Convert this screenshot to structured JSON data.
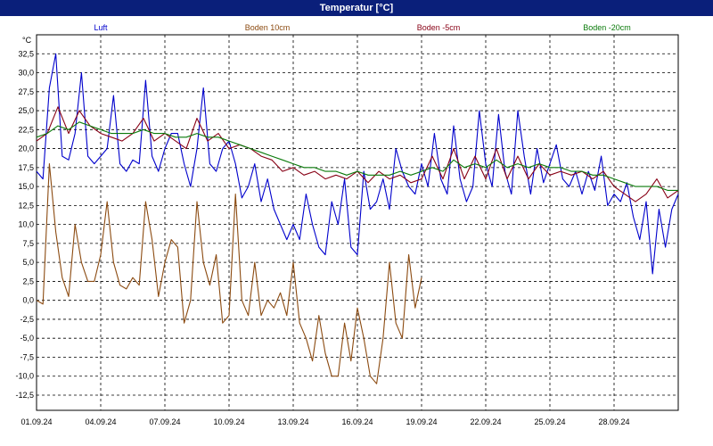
{
  "window": {
    "title": "Temperatur [°C]"
  },
  "chart_data": {
    "type": "line",
    "ylabel": "°C",
    "ylim": [
      -14.5,
      35
    ],
    "y_ticks": [
      "32,5",
      "30,0",
      "27,5",
      "25,0",
      "22,5",
      "20,0",
      "17,5",
      "15,0",
      "12,5",
      "10,0",
      "7,5",
      "5,0",
      "2,5",
      "0,0",
      "-2,5",
      "-5,0",
      "-7,5",
      "-10,0",
      "-12,5"
    ],
    "x_tick_labels": [
      "01.09.24",
      "04.09.24",
      "07.09.24",
      "10.09.24",
      "13.09.24",
      "16.09.24",
      "19.09.24",
      "22.09.24",
      "25.09.24",
      "28.09.24"
    ],
    "x_tick_days": [
      0,
      3,
      6,
      9,
      12,
      15,
      18,
      21,
      24,
      27
    ],
    "xlim_days": [
      0,
      30
    ],
    "grid": true,
    "legend_position": "top",
    "series": [
      {
        "name": "Luft",
        "color": "#0000cc",
        "x": [
          0,
          0.3,
          0.6,
          0.9,
          1.2,
          1.5,
          1.8,
          2.1,
          2.4,
          2.7,
          3.0,
          3.3,
          3.6,
          3.9,
          4.2,
          4.5,
          4.8,
          5.1,
          5.4,
          5.7,
          6.0,
          6.3,
          6.6,
          6.9,
          7.2,
          7.5,
          7.8,
          8.1,
          8.4,
          8.7,
          9.0,
          9.3,
          9.6,
          9.9,
          10.2,
          10.5,
          10.8,
          11.1,
          11.4,
          11.7,
          12.0,
          12.3,
          12.6,
          12.9,
          13.2,
          13.5,
          13.8,
          14.1,
          14.4,
          14.7,
          15.0,
          15.3,
          15.6,
          15.9,
          16.2,
          16.5,
          16.8,
          17.1,
          17.4,
          17.7,
          18.0,
          18.3,
          18.6,
          18.9,
          19.2,
          19.5,
          19.8,
          20.1,
          20.4,
          20.7,
          21.0,
          21.3,
          21.6,
          21.9,
          22.2,
          22.5,
          22.8,
          23.1,
          23.4,
          23.7,
          24.0,
          24.3,
          24.6,
          24.9,
          25.2,
          25.5,
          25.8,
          26.1,
          26.4,
          26.7,
          27.0,
          27.3,
          27.6,
          27.9,
          28.2,
          28.5,
          28.8,
          29.1,
          29.4,
          29.7,
          30.0
        ],
        "values": [
          17,
          16,
          28,
          32.5,
          19,
          18.5,
          22,
          30,
          19,
          18,
          19,
          20,
          27,
          18,
          17,
          18.5,
          18,
          29,
          19,
          17,
          20,
          22,
          22,
          18,
          15,
          20,
          28,
          18,
          17,
          20,
          21,
          18,
          13.5,
          15,
          18,
          13,
          16,
          12,
          10,
          8,
          10,
          8,
          14,
          10,
          7,
          6,
          13,
          10,
          16,
          7,
          6,
          17,
          12,
          13,
          16,
          12,
          20,
          17,
          15,
          14,
          18,
          15,
          22,
          16,
          14,
          23,
          16,
          13,
          15,
          25,
          18,
          15,
          24.5,
          17,
          14,
          25,
          19,
          14,
          20,
          15.5,
          18,
          20.5,
          16,
          15,
          17,
          14,
          17,
          14.5,
          19,
          12.5,
          14,
          13,
          15.5,
          11,
          8,
          13,
          3.5,
          12,
          7,
          12,
          14
        ]
      },
      {
        "name": "Boden 10cm",
        "color": "#8b4a10",
        "x": [
          0,
          0.3,
          0.6,
          0.9,
          1.2,
          1.5,
          1.8,
          2.1,
          2.4,
          2.7,
          3.0,
          3.3,
          3.6,
          3.9,
          4.2,
          4.5,
          4.8,
          5.1,
          5.4,
          5.7,
          6.0,
          6.3,
          6.6,
          6.9,
          7.2,
          7.5,
          7.8,
          8.1,
          8.4,
          8.7,
          9.0,
          9.3,
          9.6,
          9.9,
          10.2,
          10.5,
          10.8,
          11.1,
          11.4,
          11.7,
          12.0,
          12.3,
          12.6,
          12.9,
          13.2,
          13.5,
          13.8,
          14.1,
          14.4,
          14.7,
          15.0,
          15.3,
          15.6,
          15.9,
          16.2,
          16.5,
          16.8,
          17.1,
          17.4,
          17.7,
          18.0
        ],
        "values": [
          0,
          -0.5,
          18,
          9,
          3,
          0.5,
          10,
          5,
          2.5,
          2.5,
          6,
          13,
          5,
          2,
          1.5,
          3,
          2,
          13,
          8,
          0.5,
          5,
          8,
          7,
          -3,
          0,
          13,
          5,
          2,
          6,
          -3,
          -2,
          14,
          0,
          -2,
          5,
          -2,
          0,
          -1,
          1,
          -2,
          5,
          -3,
          -5,
          -8,
          -2,
          -7,
          -10,
          -10,
          -3,
          -8,
          -1,
          -5,
          -10,
          -11,
          -5,
          5,
          -3,
          -5,
          6,
          -1,
          3
        ]
      },
      {
        "name": "Boden -5cm",
        "color": "#880015",
        "x": [
          0,
          0.5,
          1.0,
          1.5,
          2.0,
          2.5,
          3.0,
          3.5,
          4.0,
          4.5,
          5.0,
          5.5,
          6.0,
          6.5,
          7.0,
          7.5,
          8.0,
          8.5,
          9.0,
          9.5,
          10.0,
          10.5,
          11.0,
          11.5,
          12.0,
          12.5,
          13.0,
          13.5,
          14.0,
          14.5,
          15.0,
          15.5,
          16.0,
          16.5,
          17.0,
          17.5,
          18.0,
          18.5,
          19.0,
          19.5,
          20.0,
          20.5,
          21.0,
          21.5,
          22.0,
          22.5,
          23.0,
          23.5,
          24.0,
          24.5,
          25.0,
          25.5,
          26.0,
          26.5,
          27.0,
          27.5,
          28.0,
          28.5,
          29.0,
          29.5,
          30.0
        ],
        "values": [
          21,
          22,
          25.5,
          22,
          25,
          23,
          22,
          21.5,
          21,
          22,
          24,
          21,
          22,
          21,
          20,
          24,
          21,
          22,
          20,
          20.5,
          20,
          19,
          18.5,
          17,
          17.5,
          16.5,
          17,
          16,
          16.5,
          16,
          17,
          15.5,
          17,
          16,
          16.5,
          15.5,
          16,
          19,
          16,
          20,
          16,
          19,
          16,
          20,
          16,
          19,
          16,
          18,
          16.5,
          17,
          16.5,
          17,
          16,
          17,
          15,
          14,
          13,
          14,
          16,
          13.5,
          14.5
        ]
      },
      {
        "name": "Boden -20cm",
        "color": "#0a7a0a",
        "x": [
          0,
          0.5,
          1.0,
          1.5,
          2.0,
          2.5,
          3.0,
          3.5,
          4.0,
          4.5,
          5.0,
          5.5,
          6.0,
          6.5,
          7.0,
          7.5,
          8.0,
          8.5,
          9.0,
          9.5,
          10.0,
          10.5,
          11.0,
          11.5,
          12.0,
          12.5,
          13.0,
          13.5,
          14.0,
          14.5,
          15.0,
          15.5,
          16.0,
          16.5,
          17.0,
          17.5,
          18.0,
          18.5,
          19.0,
          19.5,
          20.0,
          20.5,
          21.0,
          21.5,
          22.0,
          22.5,
          23.0,
          23.5,
          24.0,
          24.5,
          25.0,
          25.5,
          26.0,
          26.5,
          27.0,
          27.5,
          28.0,
          28.5,
          29.0,
          29.5,
          30.0
        ],
        "values": [
          21.5,
          22,
          23,
          22.5,
          23.5,
          23,
          22.5,
          22,
          22,
          22,
          22.5,
          22,
          22,
          21.5,
          21.5,
          22,
          21.5,
          21.5,
          21,
          20.5,
          20,
          19.5,
          19,
          18.5,
          18,
          17.5,
          17.5,
          17,
          17,
          16.5,
          17,
          16.5,
          16.5,
          16.5,
          17,
          16.5,
          17,
          17.5,
          17,
          18.5,
          17.5,
          18,
          17.5,
          18.5,
          17.5,
          18,
          17.5,
          18,
          17.5,
          17.5,
          17,
          17,
          16.5,
          16.5,
          16,
          15.5,
          15,
          15,
          15,
          14.5,
          14.5
        ]
      }
    ]
  }
}
